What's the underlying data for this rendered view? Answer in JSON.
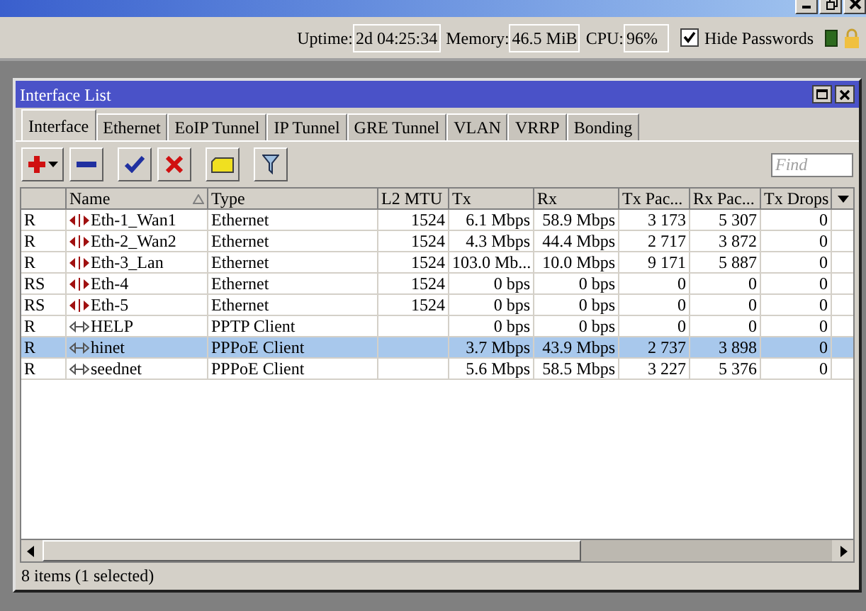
{
  "status_bar_top": {
    "uptime_label": "Uptime:",
    "uptime": "2d 04:25:34",
    "memory_label": "Memory:",
    "memory": "46.5 MiB",
    "cpu_label": "CPU:",
    "cpu": "96%",
    "hide_passwords": {
      "label": "Hide Passwords",
      "checked": true
    }
  },
  "window": {
    "title": "Interface List"
  },
  "tabs": [
    {
      "label": "Interface",
      "selected": true
    },
    {
      "label": "Ethernet",
      "selected": false
    },
    {
      "label": "EoIP Tunnel",
      "selected": false
    },
    {
      "label": "IP Tunnel",
      "selected": false
    },
    {
      "label": "GRE Tunnel",
      "selected": false
    },
    {
      "label": "VLAN",
      "selected": false
    },
    {
      "label": "VRRP",
      "selected": false
    },
    {
      "label": "Bonding",
      "selected": false
    }
  ],
  "search": {
    "placeholder": "Find"
  },
  "table": {
    "columns": [
      "Name",
      "Type",
      "L2 MTU",
      "Tx",
      "Rx",
      "Tx Pac...",
      "Rx Pac...",
      "Tx Drops"
    ],
    "rows": [
      {
        "flags": "R",
        "kind": "ethernet",
        "name": "Eth-1_Wan1",
        "type": "Ethernet",
        "l2mtu": "1524",
        "tx": "6.1 Mbps",
        "rx": "58.9 Mbps",
        "tx_packets": "3 173",
        "rx_packets": "5 307",
        "tx_drops": "0",
        "selected": false
      },
      {
        "flags": "R",
        "kind": "ethernet",
        "name": "Eth-2_Wan2",
        "type": "Ethernet",
        "l2mtu": "1524",
        "tx": "4.3 Mbps",
        "rx": "44.4 Mbps",
        "tx_packets": "2 717",
        "rx_packets": "3 872",
        "tx_drops": "0",
        "selected": false
      },
      {
        "flags": "R",
        "kind": "ethernet",
        "name": "Eth-3_Lan",
        "type": "Ethernet",
        "l2mtu": "1524",
        "tx": "103.0 Mb...",
        "rx": "10.0 Mbps",
        "tx_packets": "9 171",
        "rx_packets": "5 887",
        "tx_drops": "0",
        "selected": false
      },
      {
        "flags": "RS",
        "kind": "ethernet",
        "name": "Eth-4",
        "type": "Ethernet",
        "l2mtu": "1524",
        "tx": "0 bps",
        "rx": "0 bps",
        "tx_packets": "0",
        "rx_packets": "0",
        "tx_drops": "0",
        "selected": false
      },
      {
        "flags": "RS",
        "kind": "ethernet",
        "name": "Eth-5",
        "type": "Ethernet",
        "l2mtu": "1524",
        "tx": "0 bps",
        "rx": "0 bps",
        "tx_packets": "0",
        "rx_packets": "0",
        "tx_drops": "0",
        "selected": false
      },
      {
        "flags": "R",
        "kind": "tunnel",
        "name": "HELP",
        "type": "PPTP Client",
        "l2mtu": "",
        "tx": "0 bps",
        "rx": "0 bps",
        "tx_packets": "0",
        "rx_packets": "0",
        "tx_drops": "0",
        "selected": false
      },
      {
        "flags": "R",
        "kind": "tunnel",
        "name": "hinet",
        "type": "PPPoE Client",
        "l2mtu": "",
        "tx": "3.7 Mbps",
        "rx": "43.9 Mbps",
        "tx_packets": "2 737",
        "rx_packets": "3 898",
        "tx_drops": "0",
        "selected": true
      },
      {
        "flags": "R",
        "kind": "tunnel",
        "name": "seednet",
        "type": "PPPoE Client",
        "l2mtu": "",
        "tx": "5.6 Mbps",
        "rx": "58.5 Mbps",
        "tx_packets": "3 227",
        "rx_packets": "5 376",
        "tx_drops": "0",
        "selected": false
      }
    ]
  },
  "status_bar": "8 items (1 selected)"
}
